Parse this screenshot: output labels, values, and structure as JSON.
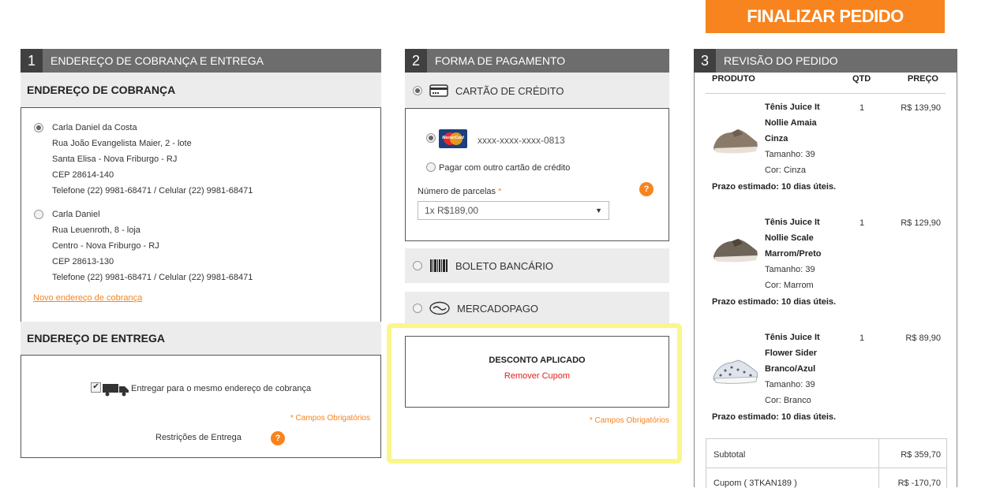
{
  "header": {
    "finalizar_label": "FINALIZAR PEDIDO"
  },
  "section1": {
    "num": "1",
    "title": "ENDEREÇO DE COBRANÇA E ENTREGA",
    "cobranca_title": "ENDEREÇO DE COBRANÇA",
    "addresses": [
      {
        "name": "Carla Daniel da Costa",
        "street": "Rua João Evangelista Maier, 2 - lote",
        "area": "Santa Elisa - Nova Friburgo - RJ",
        "cep": "CEP 28614-140",
        "phone": "Telefone (22) 9981-68471 / Celular (22) 9981-68471",
        "selected": true
      },
      {
        "name": "Carla Daniel",
        "street": "Rua Leuenroth, 8 - loja",
        "area": "Centro - Nova Friburgo - RJ",
        "cep": "CEP 28613-130",
        "phone": "Telefone (22) 9981-68471 / Celular (22) 9981-68471",
        "selected": false
      }
    ],
    "novo_endereco": "Novo endereço de cobrança",
    "entrega_title": "ENDEREÇO DE ENTREGA",
    "mesmo_endereco": "Entregar para o mesmo endereço de cobrança",
    "campos_obrigatorios": "* Campos Obrigatórios",
    "restricoes": "Restrições de Entrega",
    "help": "?"
  },
  "section2": {
    "num": "2",
    "title": "FORMA DE PAGAMENTO",
    "cartao_label": "CARTÃO DE CRÉDITO",
    "card_number": "xxxx-xxxx-xxxx-0813",
    "card_brand": "MasterCard",
    "outro_cartao": "Pagar com outro cartão de crédito",
    "parcelas_label": "Número de parcelas",
    "parcelas_required": "*",
    "parcelas_value": "1x R$189,00",
    "help": "?",
    "boleto_label": "BOLETO BANCÁRIO",
    "mercadopago_label": "MERCADOPAGO",
    "desconto_title": "DESCONTO APLICADO",
    "remover_cupom": "Remover Cupom",
    "campos_obrigatorios": "* Campos Obrigatórios"
  },
  "section3": {
    "num": "3",
    "title": "REVISÃO DO PEDIDO",
    "col_produto": "PRODUTO",
    "col_qtd": "QTD",
    "col_preco": "PREÇO",
    "items": [
      {
        "name1": "Tênis Juice It",
        "name2": "Nollie Amaia",
        "name3": "Cinza",
        "size": "Tamanho: 39",
        "color": "Cor: Cinza",
        "qty": "1",
        "price": "R$ 139,90",
        "prazo": "Prazo estimado: 10 dias úteis."
      },
      {
        "name1": "Tênis Juice It",
        "name2": "Nollie Scale",
        "name3": "Marrom/Preto",
        "size": "Tamanho: 39",
        "color": "Cor: Marrom",
        "qty": "1",
        "price": "R$ 129,90",
        "prazo": "Prazo estimado: 10 dias úteis."
      },
      {
        "name1": "Tênis Juice It",
        "name2": "Flower Sider",
        "name3": "Branco/Azul",
        "size": "Tamanho: 39",
        "color": "Cor: Branco",
        "qty": "1",
        "price": "R$ 89,90",
        "prazo": "Prazo estimado: 10 dias úteis."
      }
    ],
    "subtotal_label": "Subtotal",
    "subtotal_value": "R$ 359,70",
    "cupom_label": "Cupom ( 3TKAN189 )",
    "cupom_value": "R$ -170,70"
  },
  "colors": {
    "accent": "#f7841e",
    "header_bg": "#6d6d6d",
    "num_bg": "#404040",
    "highlight": "#faf68a",
    "error_red": "#e02020"
  }
}
